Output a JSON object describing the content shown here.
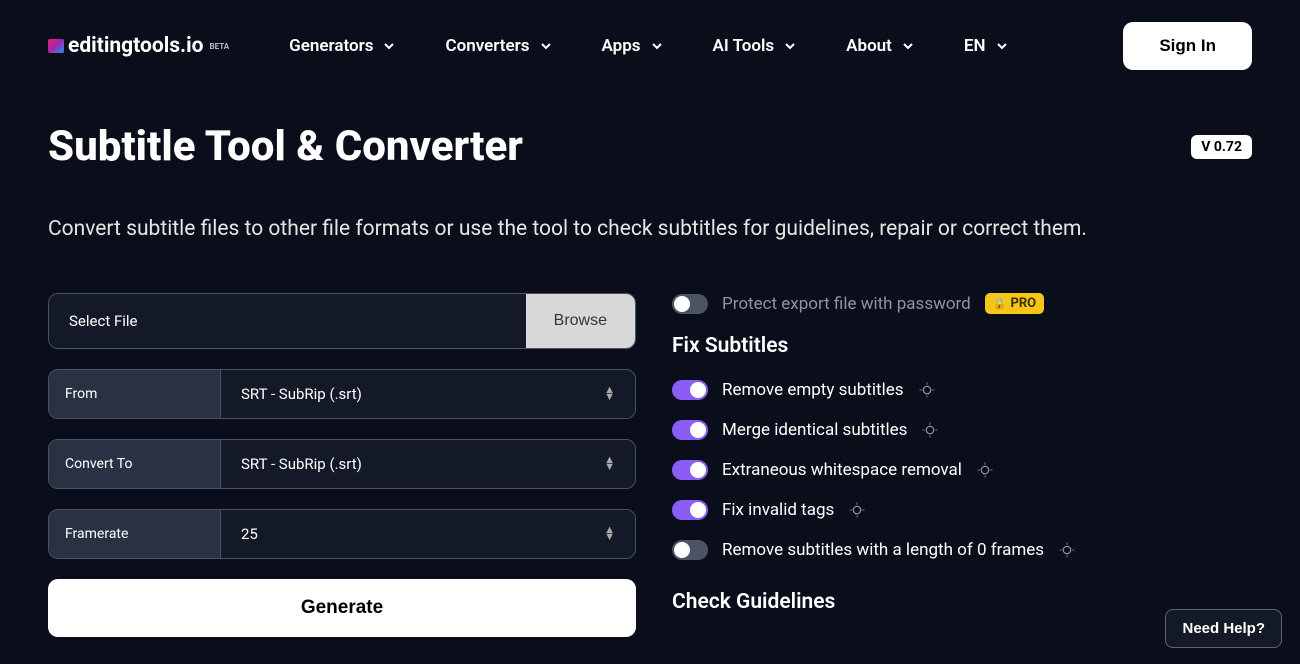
{
  "header": {
    "logo_text": "editingtools.io",
    "logo_beta": "BETA",
    "nav": [
      {
        "label": "Generators"
      },
      {
        "label": "Converters"
      },
      {
        "label": "Apps"
      },
      {
        "label": "AI Tools"
      },
      {
        "label": "About"
      },
      {
        "label": "EN"
      }
    ],
    "signin": "Sign In"
  },
  "page": {
    "title": "Subtitle Tool & Converter",
    "version": "V 0.72",
    "description": "Convert subtitle files to other file formats or use the tool to check subtitles for guidelines, repair or correct them."
  },
  "form": {
    "select_file_placeholder": "Select File",
    "browse": "Browse",
    "from_label": "From",
    "from_value": "SRT - SubRip (.srt)",
    "convert_to_label": "Convert To",
    "convert_to_value": "SRT - SubRip (.srt)",
    "framerate_label": "Framerate",
    "framerate_value": "25",
    "generate": "Generate"
  },
  "options": {
    "protect_password": "Protect export file with password",
    "pro": "PRO",
    "fix_subtitles_heading": "Fix Subtitles",
    "items": [
      {
        "label": "Remove empty subtitles",
        "on": true
      },
      {
        "label": "Merge identical subtitles",
        "on": true
      },
      {
        "label": "Extraneous whitespace removal",
        "on": true
      },
      {
        "label": "Fix invalid tags",
        "on": true
      },
      {
        "label": "Remove subtitles with a length of 0 frames",
        "on": false
      }
    ],
    "check_guidelines_heading": "Check Guidelines"
  },
  "help": "Need Help?"
}
